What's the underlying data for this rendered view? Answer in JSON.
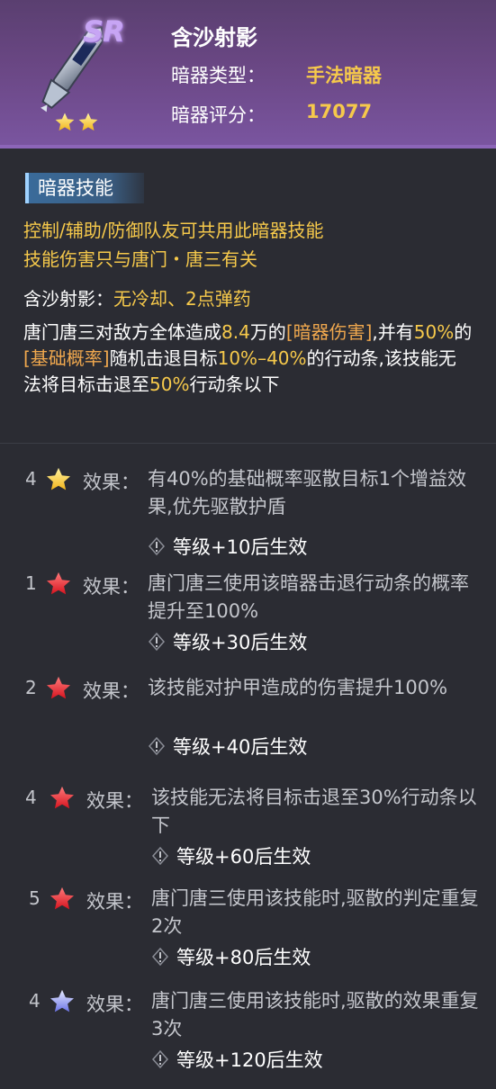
{
  "header": {
    "name": "含沙射影",
    "rarity": "SR",
    "type_label": "暗器类型：",
    "type_value": "手法暗器",
    "score_label": "暗器评分：",
    "score_value": "17077",
    "star_count": 2
  },
  "skill": {
    "section_title": "暗器技能",
    "usable_by": "控制/辅助/防御队友可共用此暗器技能",
    "damage_related": "技能伤害只与唐门・唐三有关",
    "skill_name": "含沙射影：",
    "skill_props": "无冷却、2点弹药",
    "desc": {
      "p1": "唐门唐三对敌方全体造成",
      "v1": "8.4",
      "p2": "万的",
      "t1": "[暗器伤害]",
      "p3": ",并有",
      "v2": "50%",
      "p4": "的",
      "t2": "[基础概率]",
      "p5": "随机击退目标",
      "v3": "10%–40%",
      "p6": "的行动条,该技能无法将目标击退至",
      "v4": "50%",
      "p7": "行动条以下"
    }
  },
  "effects": [
    {
      "num": "4",
      "star": "gold",
      "label": "效果：",
      "text": "有40%的基础概率驱散目标1个增益效果,优先驱散护盾",
      "req": "等级+10后生效"
    },
    {
      "num": "1",
      "star": "red",
      "label": "效果：",
      "text": "唐门唐三使用该暗器击退行动条的概率提升至100%",
      "req": "等级+30后生效"
    },
    {
      "num": "2",
      "star": "red",
      "label": "效果：",
      "text": "该技能对护甲造成的伤害提升100%",
      "req": "等级+40后生效"
    },
    {
      "num": "4",
      "star": "red",
      "label": "效果：",
      "text": "该技能无法将目标击退至30%行动条以下",
      "req": "等级+60后生效"
    },
    {
      "num": "5",
      "star": "red",
      "label": "效果：",
      "text": "唐门唐三使用该技能时,驱散的判定重复2次",
      "req": "等级+80后生效"
    },
    {
      "num": "4",
      "star": "blue",
      "label": "效果：",
      "text": "唐门唐三使用该技能时,驱散的效果重复3次",
      "req": "等级+120后生效"
    }
  ],
  "colors": {
    "gold": "#f6c94b",
    "red": "#e8313a",
    "blue": "#7f8cf5",
    "orange": "#f0a84e"
  }
}
